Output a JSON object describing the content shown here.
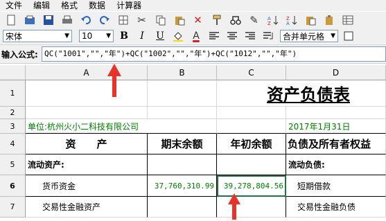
{
  "menu": [
    "文件",
    "编辑",
    "格式",
    "数据",
    "计算器"
  ],
  "toolbar2": {
    "font_name": "宋体",
    "font_size": "10",
    "bold_label": "B",
    "italic_label": "I",
    "underline_label": "U",
    "font_color_label": "A",
    "merge_label": "合并单元格"
  },
  "formula": {
    "label": "输入公式:",
    "value": "QC(\"1001\",\"\",\"年\")+QC(\"1002\",\"\",\"年\")+QC(\"1012\",\"\",\"年\")"
  },
  "columns": [
    "A",
    "B",
    "C",
    "D"
  ],
  "rows": [
    "1",
    "2",
    "3",
    "4",
    "5",
    "6",
    "7"
  ],
  "sheet": {
    "title": "资产负债表",
    "unit": "单位:杭州火小二科技有限公司",
    "date": "2017年1月31日",
    "h_asset": "资　　产",
    "h_end": "期末余额",
    "h_begin": "年初余额",
    "h_liab": "负债及所有者权益",
    "current_assets": "流动资产:",
    "current_liab": "流动负债:",
    "cash": "货币资金",
    "cash_end": "37,760,310.99",
    "cash_begin": "39,278,804.56",
    "short_loan": "短期借款",
    "trading_asset": "交易性金融资产",
    "trading_liab": "交易性金融负债"
  },
  "colors": {
    "accent_red": "#e8332a",
    "green_text": "#008000"
  }
}
